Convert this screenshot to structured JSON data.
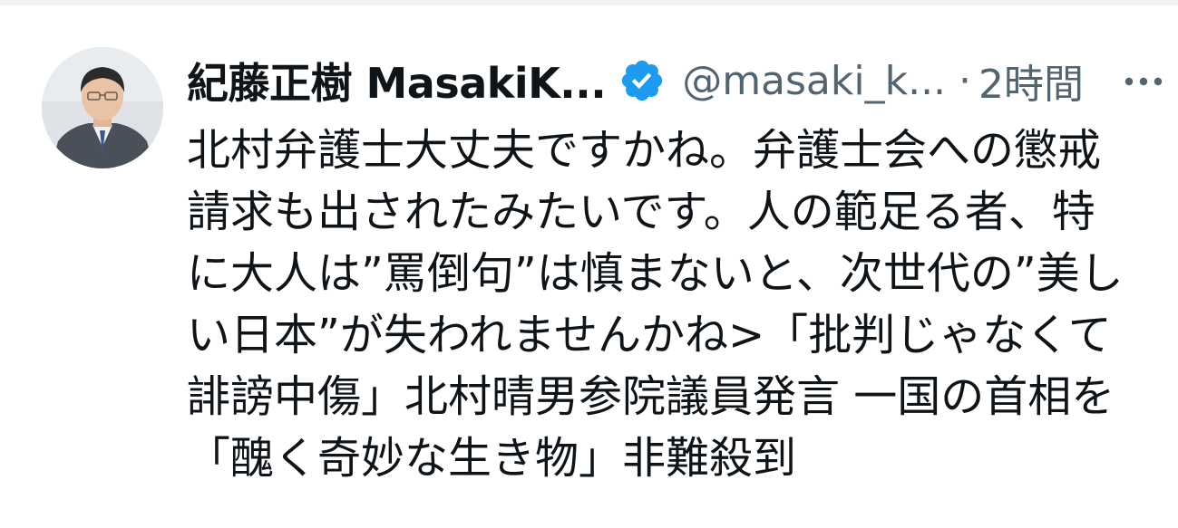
{
  "tweet": {
    "author": {
      "display_name": "紀藤正樹 MasakiK...",
      "handle": "@masaki_k...",
      "verified": true,
      "avatar_icon": "person-photo-avatar"
    },
    "separator": "·",
    "time": "2時間",
    "more_icon": "more-options-icon",
    "text_lines": [
      "北村弁護士大丈夫ですかね。弁護士会への懲戒",
      "請求も出されたみたいです。人の範足る者、特",
      "に大人は”罵倒句”は慎まないと、次世代の”美し",
      "い日本”が失われませんかね>「批判じゃなくて",
      "誹謗中傷」北村晴男参院議員発言 一国の首相を",
      "「醜く奇妙な生き物」非難殺到"
    ]
  },
  "colors": {
    "verified_badge": "#1d9bf0",
    "secondary_text": "#536471",
    "primary_text": "#0f1419",
    "divider": "#eff3f4"
  }
}
